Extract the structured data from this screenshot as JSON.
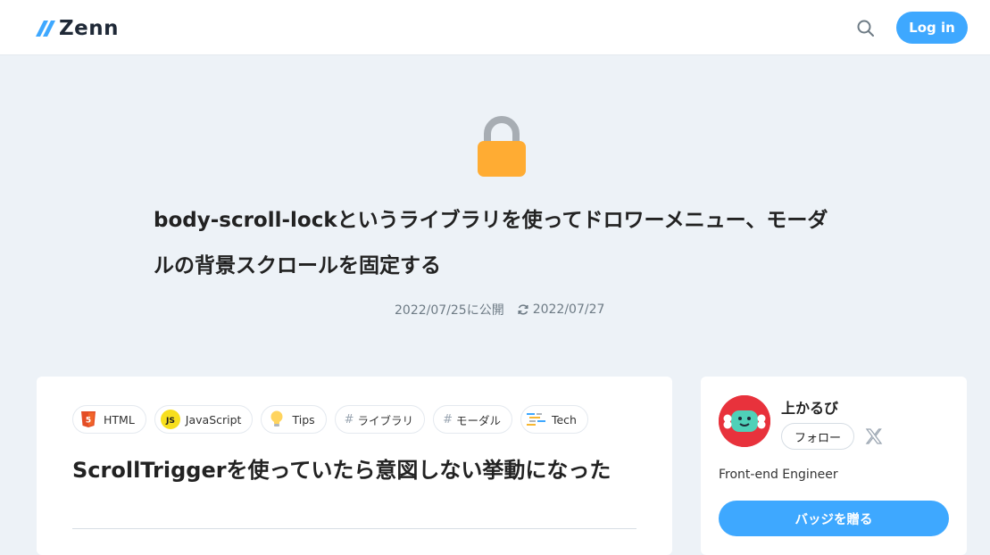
{
  "header": {
    "logo_text": "Zenn",
    "login_label": "Log in",
    "accent_color": "#3ea8ff"
  },
  "article": {
    "emoji": "lock-icon",
    "title": "body-scroll-lockというライブラリを使ってドロワーメニュー、モーダルの背景スクロールを固定する",
    "published": "2022/07/25に公開",
    "updated": "2022/07/27",
    "tags": [
      {
        "label": "HTML",
        "icon": "html5-icon"
      },
      {
        "label": "JavaScript",
        "icon": "javascript-icon"
      },
      {
        "label": "Tips",
        "icon": "lightbulb-icon"
      },
      {
        "label": "ライブラリ",
        "icon": "hash"
      },
      {
        "label": "モーダル",
        "icon": "hash"
      },
      {
        "label": "Tech",
        "icon": "tech-icon"
      }
    ],
    "toc_heading": "ScrollTriggerを使っていたら意図しない挙動になった"
  },
  "author": {
    "name": "上かるび",
    "follow_label": "フォロー",
    "bio": "Front-end Engineer",
    "badge_label": "バッジを贈る"
  }
}
